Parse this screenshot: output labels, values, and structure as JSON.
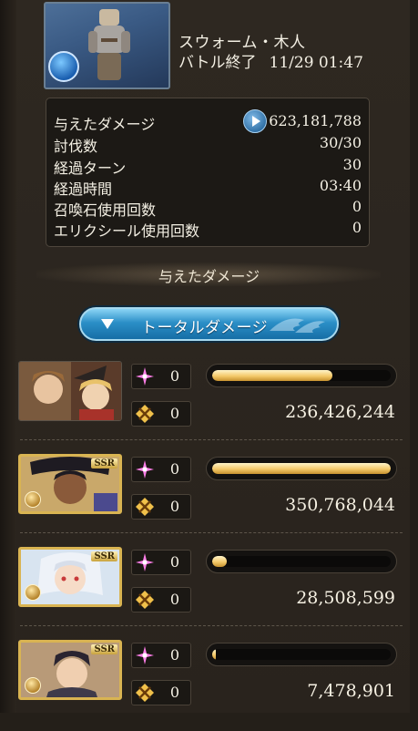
{
  "boss": {
    "name": "スウォーム・木人",
    "status": "バトル終了",
    "datetime": "11/29 01:47"
  },
  "stats": [
    {
      "label": "与えたダメージ",
      "value": "623,181,788"
    },
    {
      "label": "討伐数",
      "value": "30/30"
    },
    {
      "label": "経過ターン",
      "value": "30"
    },
    {
      "label": "経過時間",
      "value": "03:40"
    },
    {
      "label": "召喚石使用回数",
      "value": "0"
    },
    {
      "label": "エリクシール使用回数",
      "value": "0"
    }
  ],
  "section_title": "与えたダメージ",
  "dropdown": {
    "selected": "トータルダメージ"
  },
  "characters": [
    {
      "rarity": "",
      "skill_count": "0",
      "ougi_count": "0",
      "damage": "236,426,244",
      "damage_share": 0.674
    },
    {
      "rarity": "SSR",
      "skill_count": "0",
      "ougi_count": "0",
      "damage": "350,768,044",
      "damage_share": 1.0
    },
    {
      "rarity": "SSR",
      "skill_count": "0",
      "ougi_count": "0",
      "damage": "28,508,599",
      "damage_share": 0.081
    },
    {
      "rarity": "SSR",
      "skill_count": "0",
      "ougi_count": "0",
      "damage": "7,478,901",
      "damage_share": 0.021
    }
  ],
  "colors": {
    "bar_fill": "#f4c96a",
    "dropdown": "#2b8fc7",
    "skill_icon": "#ff7ee8",
    "ougi_icon": "#f0c04a"
  }
}
